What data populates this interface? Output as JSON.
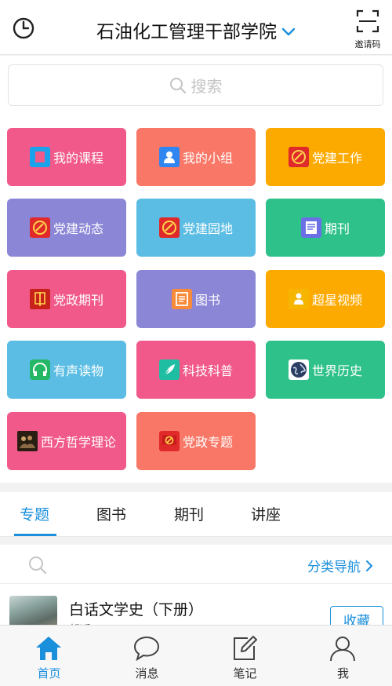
{
  "header": {
    "title": "石油化工管理干部学院",
    "invite_label": "邀请码"
  },
  "search": {
    "placeholder": "搜索"
  },
  "tiles": [
    {
      "label": "我的课程",
      "color": "#f0598a",
      "icon": "course-icon"
    },
    {
      "label": "我的小组",
      "color": "#f97767",
      "icon": "group-icon"
    },
    {
      "label": "党建工作",
      "color": "#fdaa00",
      "icon": "party-emblem-icon"
    },
    {
      "label": "党建动态",
      "color": "#8b86d6",
      "icon": "party-emblem-icon"
    },
    {
      "label": "党建园地",
      "color": "#5bbde3",
      "icon": "party-emblem-icon"
    },
    {
      "label": "期刊",
      "color": "#2fc18a",
      "icon": "journal-icon"
    },
    {
      "label": "党政期刊",
      "color": "#f0598a",
      "icon": "party-journal-icon"
    },
    {
      "label": "图书",
      "color": "#8b86d6",
      "icon": "book-icon"
    },
    {
      "label": "超星视频",
      "color": "#fdaa00",
      "icon": "video-lecture-icon"
    },
    {
      "label": "有声读物",
      "color": "#5bbde3",
      "icon": "audiobook-icon"
    },
    {
      "label": "科技科普",
      "color": "#f0598a",
      "icon": "feather-icon"
    },
    {
      "label": "世界历史",
      "color": "#2fc18a",
      "icon": "globe-icon"
    },
    {
      "label": "西方哲学理论",
      "color": "#f0598a",
      "icon": "painting-icon"
    },
    {
      "label": "党政专题",
      "color": "#f97767",
      "icon": "party-flag-icon"
    }
  ],
  "tabs": [
    {
      "label": "专题",
      "active": true
    },
    {
      "label": "图书",
      "active": false
    },
    {
      "label": "期刊",
      "active": false
    },
    {
      "label": "讲座",
      "active": false
    }
  ],
  "content": {
    "category_nav_label": "分类导航",
    "book": {
      "title": "白话文学史（下册）",
      "author": "胡适",
      "favorite_label": "收藏"
    }
  },
  "bottom_nav": [
    {
      "label": "首页",
      "icon": "home-icon",
      "active": true
    },
    {
      "label": "消息",
      "icon": "message-icon",
      "active": false
    },
    {
      "label": "笔记",
      "icon": "note-icon",
      "active": false
    },
    {
      "label": "我",
      "icon": "user-icon",
      "active": false
    }
  ],
  "colors": {
    "accent": "#1a8fdc"
  }
}
